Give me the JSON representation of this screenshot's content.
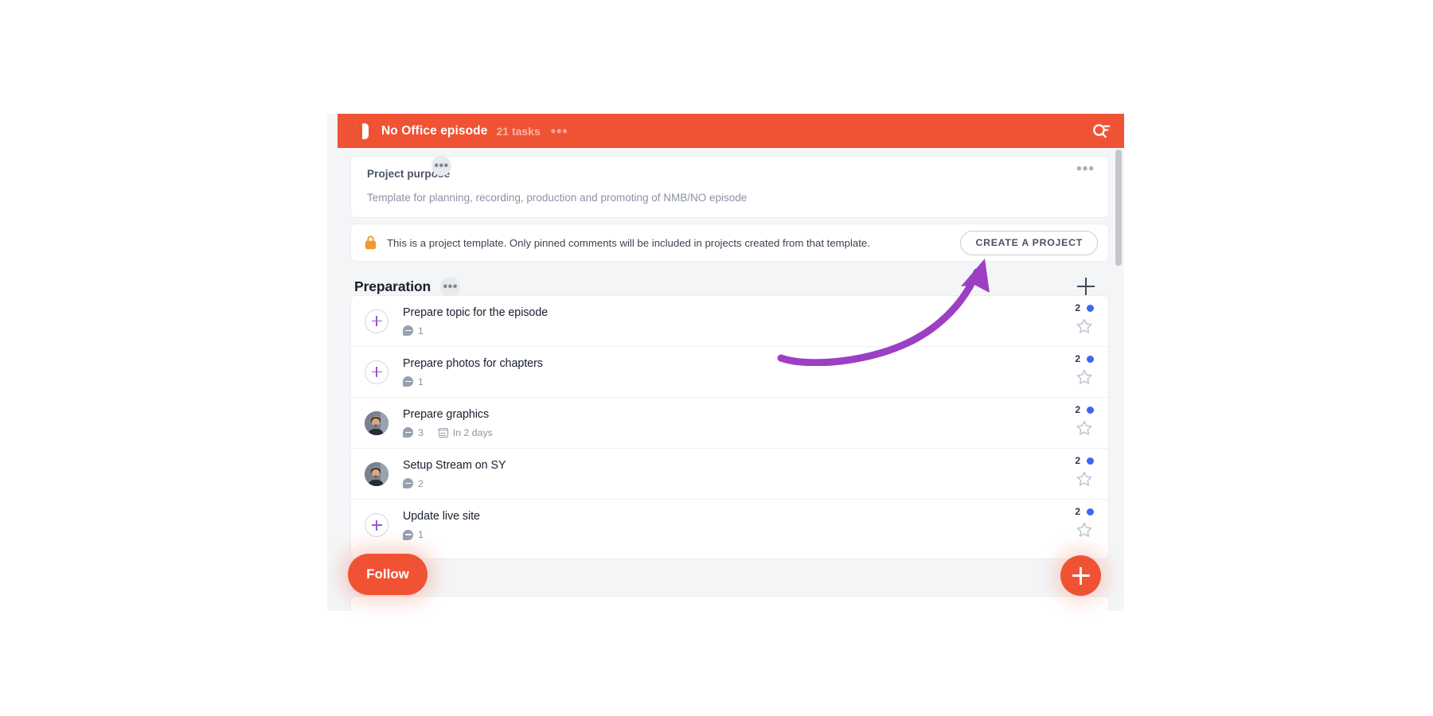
{
  "header": {
    "logo_icon": "half-circle-logo-icon",
    "title": "No Office episode",
    "task_count": "21 tasks",
    "menu_label": "•••",
    "search_icon": "search-filter-icon"
  },
  "purpose": {
    "title": "Project purpose",
    "description": "Template for planning, recording, production and promoting of NMB/NO episode",
    "menu_label": "•••"
  },
  "banner": {
    "icon": "lock-icon",
    "text": "This is a project template. Only pinned comments will be included in projects created from that template.",
    "button_label": "CREATE A PROJECT"
  },
  "section": {
    "title": "Preparation",
    "menu_label": "•••",
    "add_icon": "plus-icon"
  },
  "bottom_section": {
    "menu_label": "•••"
  },
  "tasks": [
    {
      "title": "Prepare topic for the episode",
      "avatar": "add-assignee-placeholder",
      "comments": "1",
      "due": null,
      "badge_count": "2",
      "badge_dot": true,
      "star_icon": "star-outline-icon"
    },
    {
      "title": "Prepare photos for chapters",
      "avatar": "add-assignee-placeholder",
      "comments": "1",
      "due": null,
      "badge_count": "2",
      "badge_dot": true,
      "star_icon": "star-outline-icon"
    },
    {
      "title": "Prepare graphics",
      "avatar": "user-photo",
      "comments": "3",
      "due": "In 2 days",
      "badge_count": "2",
      "badge_dot": true,
      "star_icon": "star-outline-icon"
    },
    {
      "title": "Setup Stream on SY",
      "avatar": "user-photo",
      "comments": "2",
      "due": null,
      "badge_count": "2",
      "badge_dot": true,
      "star_icon": "star-outline-icon"
    },
    {
      "title": "Update live site",
      "avatar": "add-assignee-placeholder",
      "comments": "1",
      "due": null,
      "badge_count": "2",
      "badge_dot": true,
      "star_icon": "star-outline-icon"
    }
  ],
  "follow": {
    "label": "Follow"
  },
  "fab": {
    "icon": "plus-icon"
  },
  "annotation": {
    "shape": "curved-arrow",
    "color": "#9c3fc4"
  },
  "colors": {
    "brand_orange": "#ef5334",
    "badge_blue": "#3b68f0",
    "accent_purple": "#9b59d0",
    "annotation_purple": "#9c3fc4",
    "lock_orange": "#f0992c"
  }
}
